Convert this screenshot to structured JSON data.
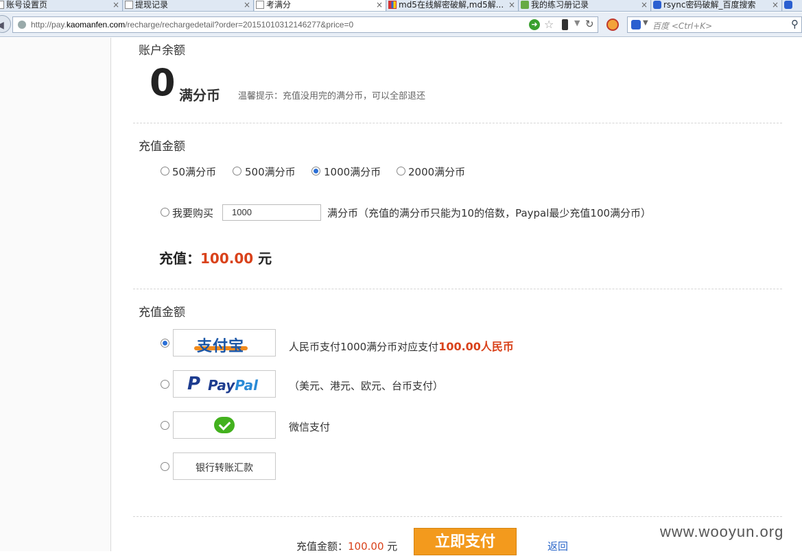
{
  "browser": {
    "tabs": [
      {
        "label": "账号设置页",
        "icon": "doc",
        "active": false
      },
      {
        "label": "提现记录",
        "icon": "doc",
        "active": false
      },
      {
        "label": "考满分",
        "icon": "doc",
        "active": true
      },
      {
        "label": "md5在线解密破解,md5解...",
        "icon": "grid",
        "active": false
      },
      {
        "label": "我的练习册记录",
        "icon": "leaf",
        "active": false
      },
      {
        "label": "rsync密码破解_百度搜索",
        "icon": "paw",
        "active": false
      }
    ],
    "tab_close_glyph": "×",
    "url_prefix": "http://pay.",
    "url_domain": "kaomanfen.com",
    "url_suffix": "/recharge/rechargedetail?order=20151010312146277&price=0",
    "search_placeholder": "百度 <Ctrl+K>"
  },
  "balance": {
    "title": "账户余额",
    "value": "0",
    "unit": "满分币",
    "tip": "温馨提示：充值没用完的满分币，可以全部退还"
  },
  "recharge": {
    "title": "充值金额",
    "options": [
      {
        "label": "50满分币",
        "selected": false
      },
      {
        "label": "500满分币",
        "selected": false
      },
      {
        "label": "1000满分币",
        "selected": true
      },
      {
        "label": "2000满分币",
        "selected": false
      }
    ],
    "custom_label": "我要购买",
    "custom_value": "1000",
    "custom_note": "满分币（充值的满分币只能为10的倍数，Paypal最少充值100满分币）",
    "total_label": "充值：",
    "total_amount": "100.00",
    "total_unit": "元"
  },
  "payment": {
    "title": "充值金额",
    "methods": [
      {
        "name": "alipay",
        "logo_text": "支付宝",
        "selected": true,
        "desc": "人民币支付1000满分币对应支付",
        "desc_highlight": "100.00人民币"
      },
      {
        "name": "paypal",
        "logo_p": "P",
        "logo_word1": "Pay",
        "logo_word2": "Pal",
        "selected": false,
        "desc": "（美元、港元、欧元、台币支付）"
      },
      {
        "name": "wechat",
        "selected": false,
        "desc": "微信支付"
      },
      {
        "name": "bank",
        "logo_text": "银行转账汇款",
        "selected": false
      }
    ]
  },
  "footer": {
    "amount_label": "充值金额：",
    "amount": "100.00",
    "amount_unit": " 元",
    "pay_button": "立即支付",
    "back_link": "返回"
  },
  "watermark": "www.wooyun.org",
  "colors": {
    "accent": "#d9421b",
    "button": "#f39a1d",
    "link": "#2a66c9",
    "radio": "#2b6fd6"
  }
}
